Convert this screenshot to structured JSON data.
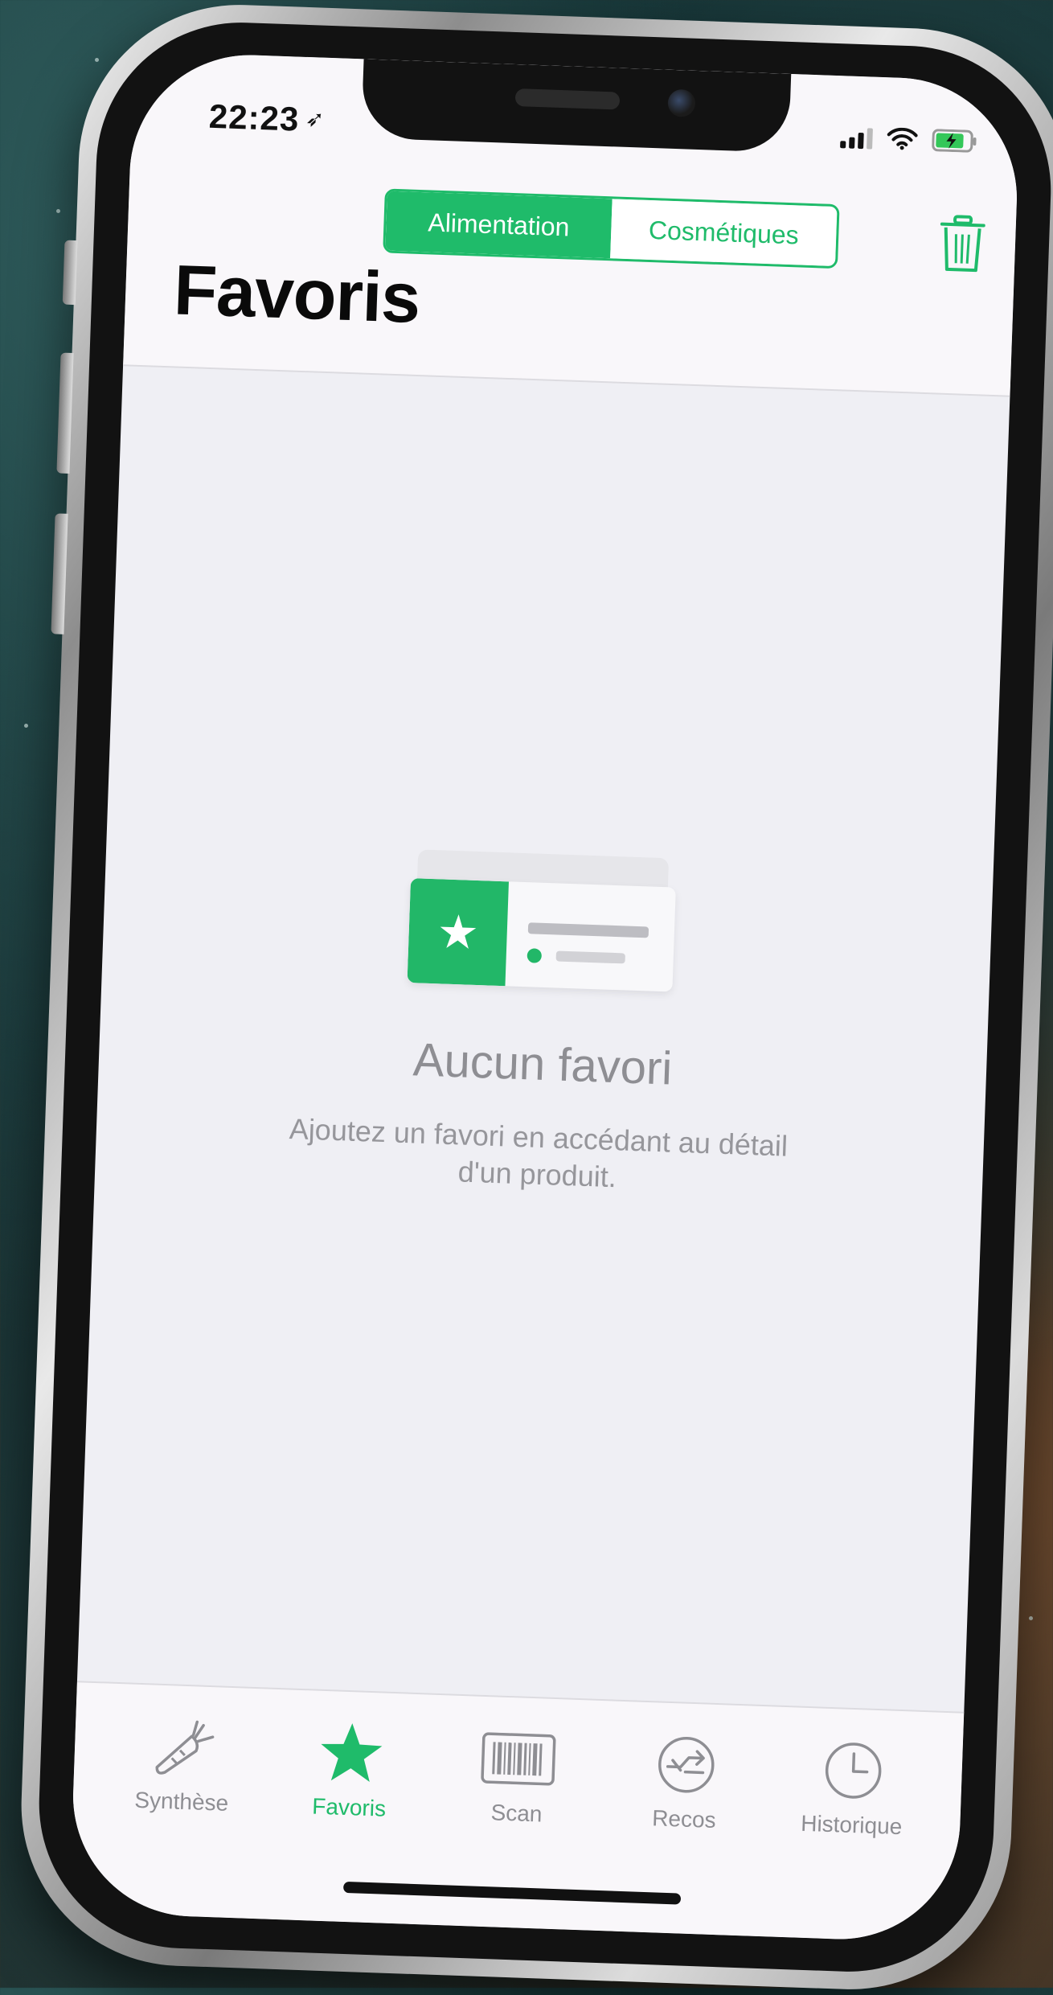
{
  "status_bar": {
    "time": "22:23",
    "location_icon": "location-arrow-icon",
    "signal_icon": "cellular-signal-icon",
    "wifi_icon": "wifi-icon",
    "battery_icon": "battery-charging-icon"
  },
  "header": {
    "segments": [
      {
        "label": "Alimentation",
        "active": true
      },
      {
        "label": "Cosmétiques",
        "active": false
      }
    ],
    "trash_icon": "trash-icon",
    "title": "Favoris"
  },
  "empty_state": {
    "illustration_icon": "favorite-card-illustration",
    "title": "Aucun favori",
    "subtitle": "Ajoutez un favori en accédant au détail d'un produit."
  },
  "tab_bar": {
    "items": [
      {
        "label": "Synthèse",
        "icon": "carrot-icon",
        "active": false
      },
      {
        "label": "Favoris",
        "icon": "star-icon",
        "active": true
      },
      {
        "label": "Scan",
        "icon": "barcode-icon",
        "active": false
      },
      {
        "label": "Recos",
        "icon": "recommendations-icon",
        "active": false
      },
      {
        "label": "Historique",
        "icon": "clock-icon",
        "active": false
      }
    ]
  },
  "colors": {
    "accent": "#1fbb6a",
    "inactive_gray": "#8e8e93",
    "background": "#efeff4",
    "bar_background": "#f9f7fa"
  }
}
